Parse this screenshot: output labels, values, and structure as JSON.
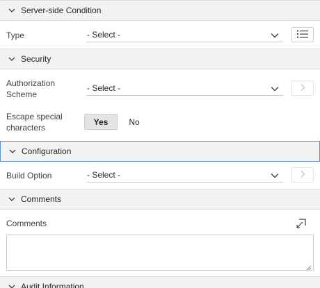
{
  "sections": {
    "server_side_condition": {
      "title": "Server-side Condition"
    },
    "security": {
      "title": "Security"
    },
    "configuration": {
      "title": "Configuration"
    },
    "comments": {
      "title": "Comments"
    },
    "audit_information": {
      "title": "Audit Information"
    }
  },
  "fields": {
    "type": {
      "label": "Type",
      "value": "- Select -",
      "side_icon": "list-icon"
    },
    "authorization_scheme": {
      "label_line1": "Authorization",
      "label_line2": "Scheme",
      "value": "- Select -",
      "side_icon": "chevron-right-icon"
    },
    "escape_special_characters": {
      "label_line1": "Escape special",
      "label_line2": "characters",
      "options": [
        "Yes",
        "No"
      ],
      "selected": "Yes"
    },
    "build_option": {
      "label": "Build Option",
      "value": "- Select -",
      "side_icon": "chevron-right-icon"
    },
    "comments": {
      "label": "Comments",
      "value": "",
      "expand_icon": "expand-icon"
    }
  },
  "colors": {
    "header_bg": "#f2f2f2",
    "active_border": "#5d92c4",
    "toggle_selected_bg": "#e4e4e4"
  }
}
